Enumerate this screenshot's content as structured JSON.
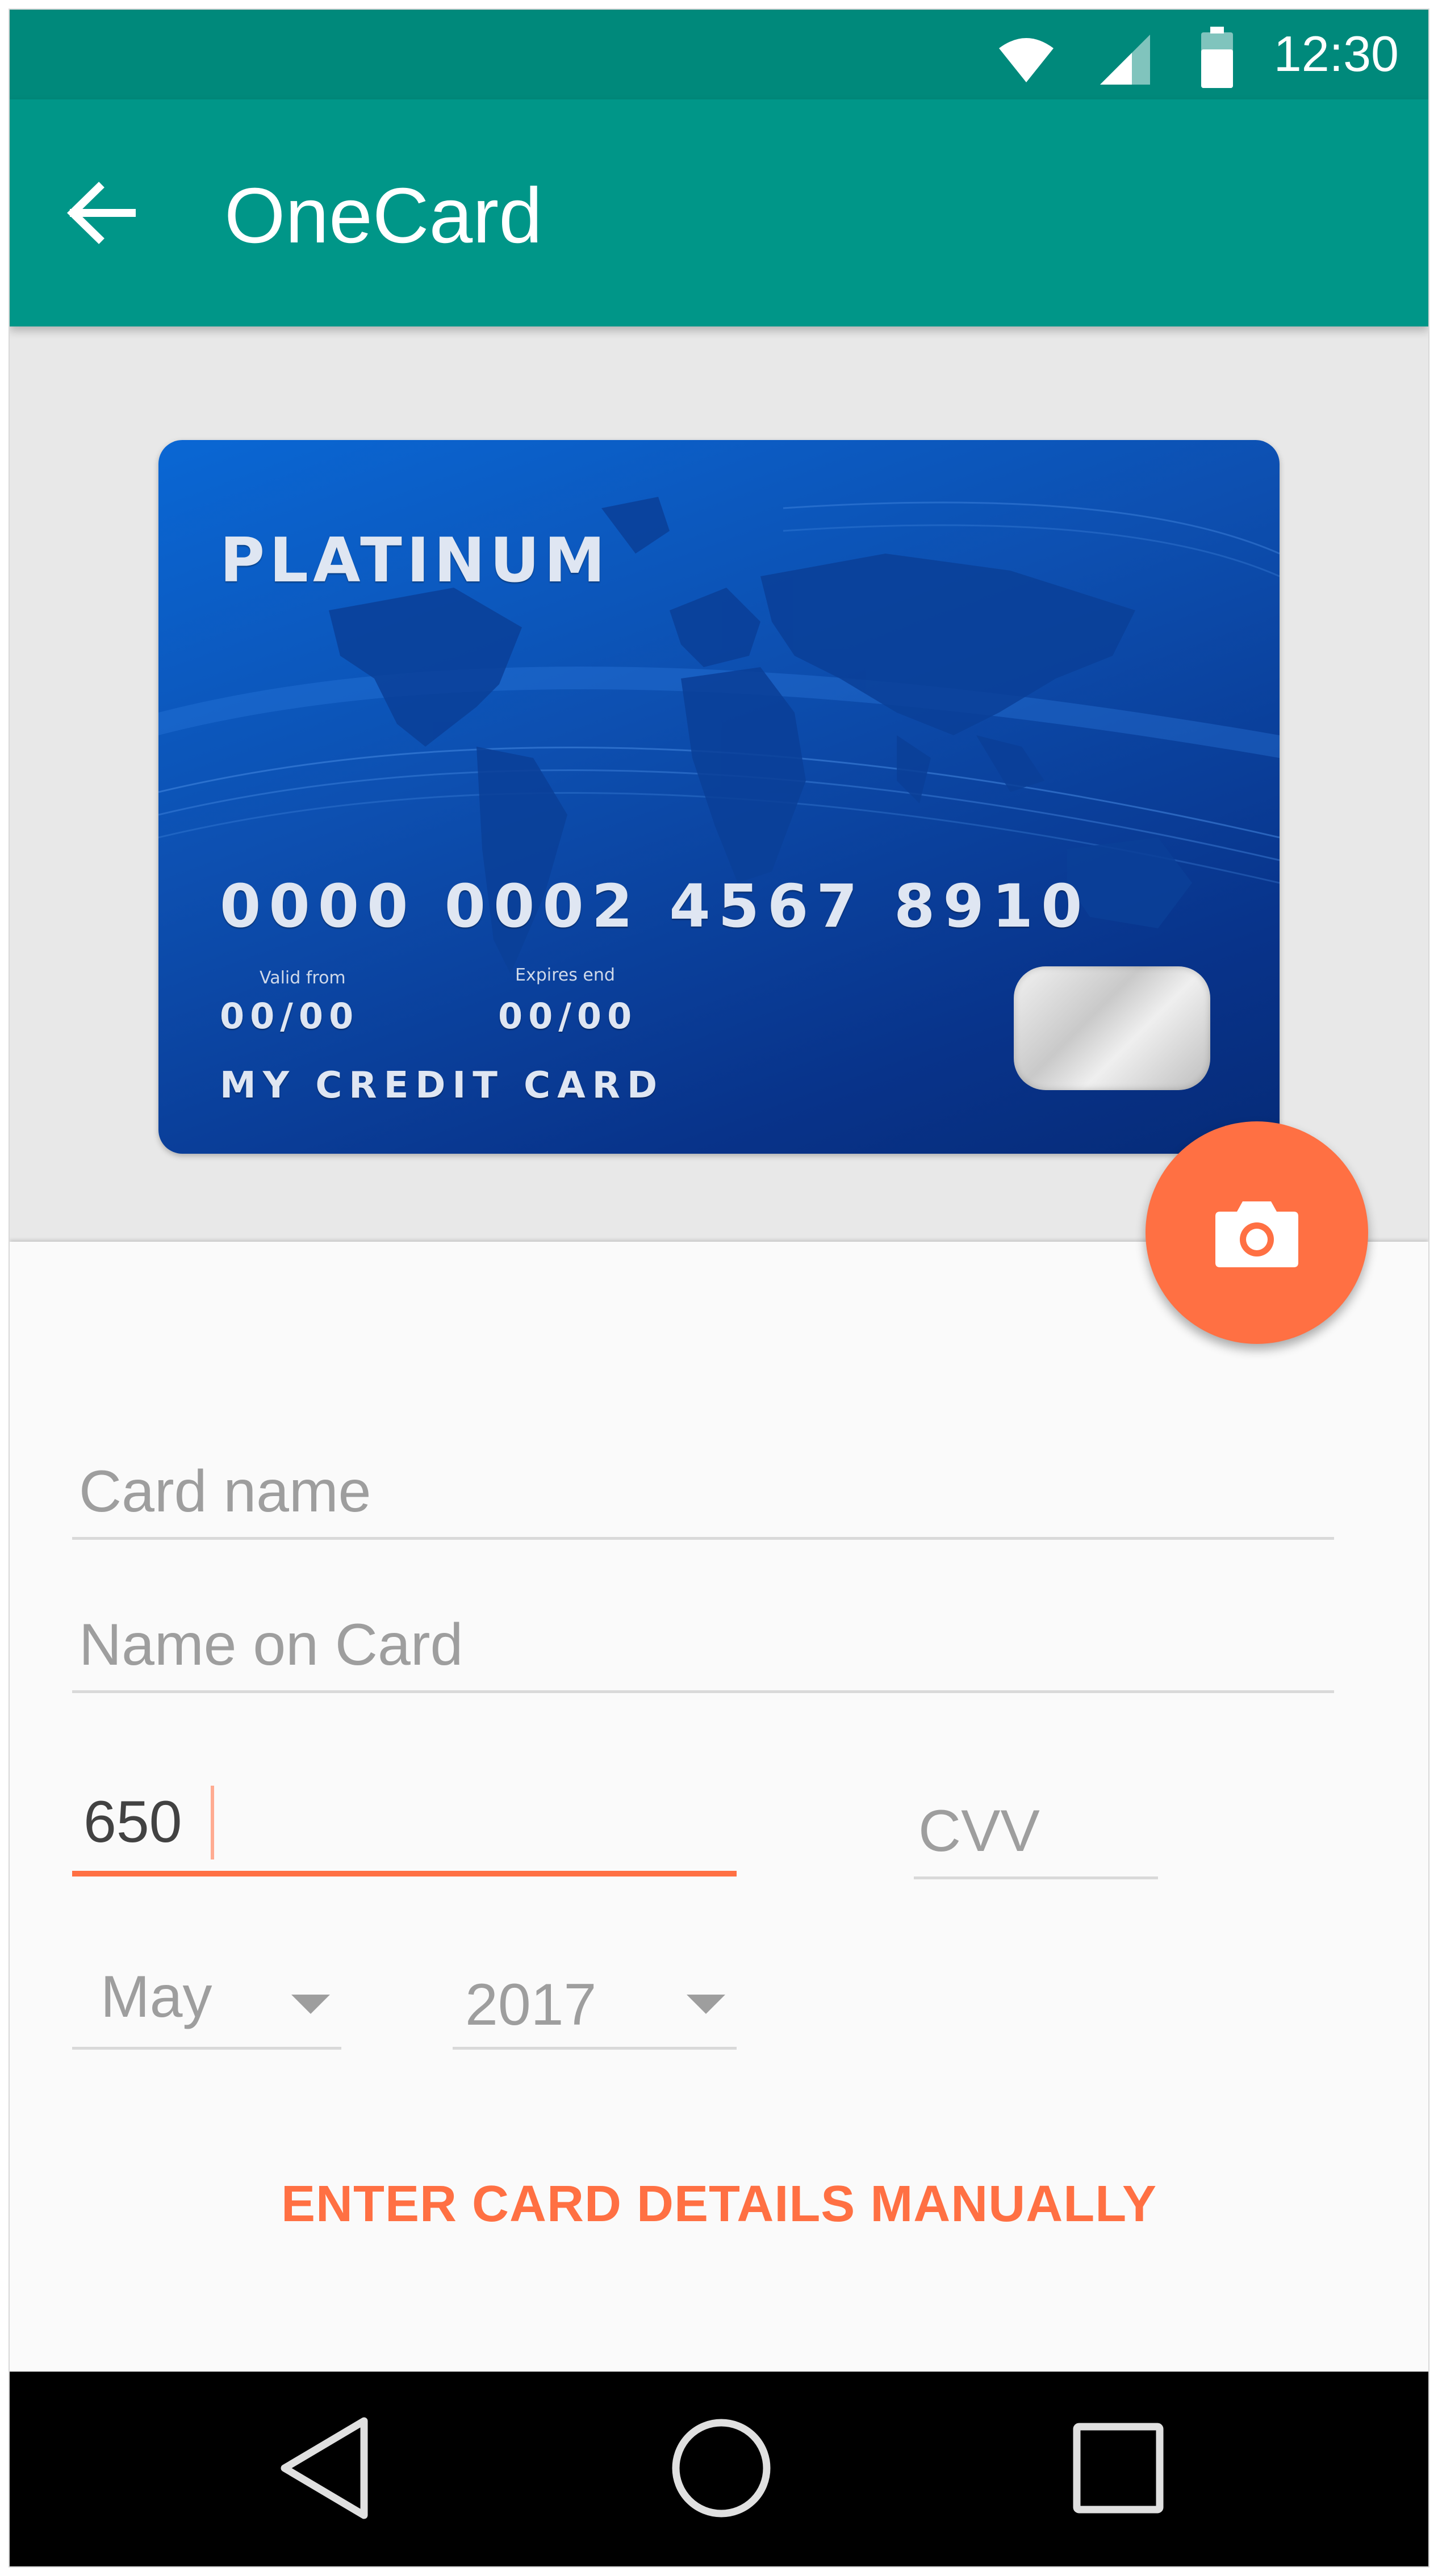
{
  "status_bar": {
    "time": "12:30",
    "icons": [
      "wifi-icon",
      "signal-icon",
      "battery-icon"
    ]
  },
  "app_bar": {
    "title": "OneCard",
    "back_icon": "arrow-left-icon"
  },
  "card": {
    "tier": "PLATINUM",
    "number": "0000 0002 4567 8910",
    "valid_from_label": "Valid  from",
    "valid_from_value": "00/00",
    "expires_label": "Expires  end",
    "expires_value": "00/00",
    "holder": "MY CREDIT CARD"
  },
  "form": {
    "card_name_placeholder": "Card name",
    "name_on_card_placeholder": "Name on Card",
    "card_number_value": "650",
    "cvv_placeholder": "CVV",
    "month_value": "May",
    "year_value": "2017",
    "manual_entry_label": "ENTER CARD DETAILS MANUALLY"
  },
  "fab": {
    "icon": "camera-icon"
  },
  "nav_bar": {
    "icons": [
      "back-triangle-icon",
      "home-circle-icon",
      "recents-square-icon"
    ]
  },
  "colors": {
    "status_bar": "#00897b",
    "app_bar": "#009688",
    "accent": "#ff7043",
    "card_blue": "#0d4fb0"
  }
}
